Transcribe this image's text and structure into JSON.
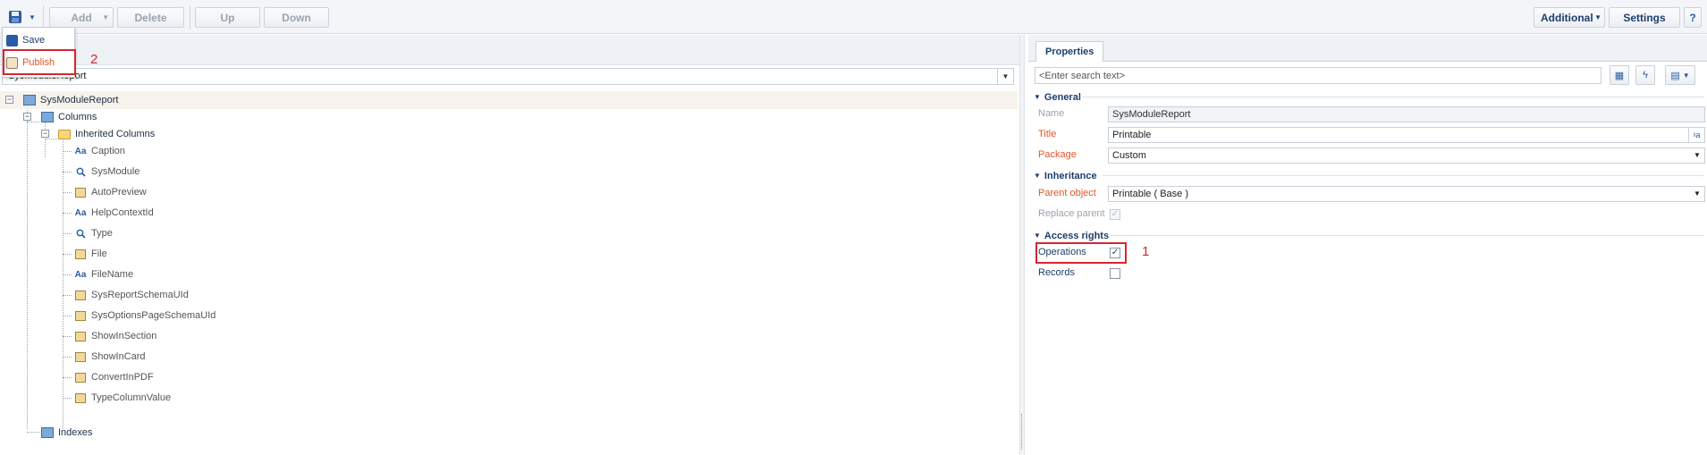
{
  "toolbar": {
    "add_label": "Add",
    "delete_label": "Delete",
    "up_label": "Up",
    "down_label": "Down",
    "additional_label": "Additional",
    "settings_label": "Settings",
    "help_label": "?"
  },
  "save_menu": {
    "save_label": "Save",
    "publish_label": "Publish"
  },
  "annotations": {
    "publish_marker": "2",
    "operations_marker": "1"
  },
  "schema_select": {
    "value": "SysModuleReport"
  },
  "tree": {
    "root": "SysModuleReport",
    "columns": "Columns",
    "inherited": "Inherited Columns",
    "items": [
      {
        "label": "Caption",
        "icon": "text-icon"
      },
      {
        "label": "SysModule",
        "icon": "lookup-icon"
      },
      {
        "label": "AutoPreview",
        "icon": "boolean-icon"
      },
      {
        "label": "HelpContextId",
        "icon": "text-icon"
      },
      {
        "label": "Type",
        "icon": "lookup-icon"
      },
      {
        "label": "File",
        "icon": "binary-icon"
      },
      {
        "label": "FileName",
        "icon": "text-icon"
      },
      {
        "label": "SysReportSchemaUId",
        "icon": "guid-icon"
      },
      {
        "label": "SysOptionsPageSchemaUId",
        "icon": "guid-icon"
      },
      {
        "label": "ShowInSection",
        "icon": "boolean-icon"
      },
      {
        "label": "ShowInCard",
        "icon": "boolean-icon"
      },
      {
        "label": "ConvertInPDF",
        "icon": "boolean-icon"
      },
      {
        "label": "TypeColumnValue",
        "icon": "guid-icon"
      }
    ],
    "indexes": "Indexes"
  },
  "properties": {
    "tab_label": "Properties",
    "search_placeholder": "<Enter search text>",
    "general": {
      "header": "General",
      "name_label": "Name",
      "name_value": "SysModuleReport",
      "title_label": "Title",
      "title_value": "Printable",
      "package_label": "Package",
      "package_value": "Custom"
    },
    "inheritance": {
      "header": "Inheritance",
      "parent_label": "Parent object",
      "parent_value": "Printable ( Base )",
      "replace_label": "Replace parent"
    },
    "access": {
      "header": "Access rights",
      "operations_label": "Operations",
      "records_label": "Records"
    }
  },
  "colors": {
    "accent": "#1d3e6c",
    "required": "#e2562b",
    "highlight": "#d7262f"
  }
}
